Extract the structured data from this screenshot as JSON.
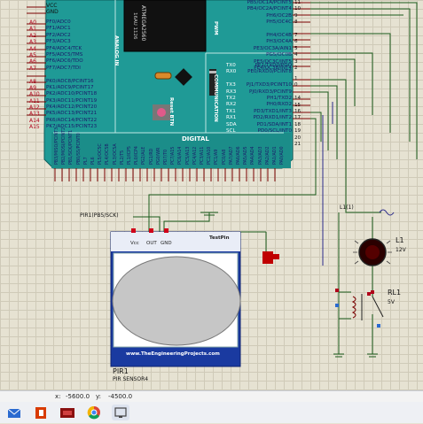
{
  "board": {
    "power_pins": [
      "VCC",
      "GND"
    ],
    "analog_pins": [
      "A0",
      "A1",
      "A2",
      "A3",
      "A4",
      "A5",
      "A6",
      "A7",
      "",
      "A8",
      "A9",
      "A10",
      "A11",
      "A12",
      "A13",
      "A14",
      "A15"
    ],
    "analog_ports": [
      "PF0/ADC0",
      "PF1/ADC1",
      "PF2/ADC2",
      "PF3/ADC3",
      "PF4/ADC4/TCK",
      "PF5/ADC5/TMS",
      "PF6/ADC6/TDO",
      "PF7/ADC7/TDI",
      "",
      "PK0/ADC8/PCINT16",
      "PK1/ADC9/PCINT17",
      "PK2/ADC10/PCINT18",
      "PK3/ADC11/PCINT19",
      "PK4/ADC12/PCINT20",
      "PK5/ADC13/PCINT21",
      "PK6/ADC14/PCINT22",
      "PK7/ADC15/PCINT23"
    ],
    "chip_label": "ATMEGA2560",
    "chip_sub": "16AU 1126",
    "analog_in_label": "ANALOG IN",
    "pwm_label": "PWM",
    "communication_label": "COMMUNICATION",
    "reset_label": "Reset BTN",
    "digital_label": "DIGITAL",
    "pwm_ports": [
      "PB5/OC1A/PCINT5",
      "PB4/OC2A/PCINT4",
      "PH6/OC2B",
      "PH5/OC4C",
      "",
      "PH4/OC4B",
      "PH3/OC4A",
      "PE3/OC3A/AIN1",
      "PG5/OC0B",
      "PE5/OC3C/INT5",
      "PE4/OC3B/INT4"
    ],
    "pwm_numbers": [
      "11",
      "10",
      "9",
      "8",
      "",
      "7",
      "6",
      "5",
      "4",
      "3",
      "2"
    ],
    "comm_ports": [
      "PE1/TXD0/PDO",
      "PE0/RXD0/PCINT8",
      "",
      "PJ1/TXD3/PCINT10",
      "PJ0/RXD3/PCINT9",
      "PH1/TXD2",
      "PH0/RXD2",
      "PD3/TXD1/INT3",
      "PD2/RXD1/INT2",
      "PD1/SDA/INT1",
      "PD0/SCL/INT0"
    ],
    "comm_labels": [
      "TX0",
      "RX0",
      "",
      "TX3",
      "RX3",
      "TX2",
      "RX2",
      "TX1",
      "RX1",
      "SDA",
      "SCL"
    ],
    "comm_numbers": [
      "1",
      "0",
      "",
      "14",
      "15",
      "16",
      "17",
      "18",
      "19",
      "20",
      "21"
    ],
    "digital_ports": [
      "PB3/MISO/PCINT3",
      "PB2/MOSI/PCINT2",
      "PB1/SCK/PCINT1",
      "PB0/SS/PCINT0",
      "PL7",
      "PL6",
      "PL5/OC5C",
      "PL4/OC5B",
      "PL3/OC5A",
      "PL2/T5",
      "PL1/ICP5",
      "PL0/ICP4",
      "PG2/ALE",
      "PG1/RD",
      "PG0/WR",
      "PD7/T0",
      "PC7/A15",
      "PC6/A14",
      "PC5/A13",
      "PC4/A12",
      "PC3/A11",
      "PC2/A10",
      "PC1/A9",
      "PC0/A8",
      "PA7/AD7",
      "PA6/AD6",
      "PA5/AD5",
      "PA4/AD4",
      "PA3/AD3",
      "PA2/AD2",
      "PA1/AD1",
      "PA0/AD0"
    ]
  },
  "pir": {
    "net_label": "PIR1(PB5/SCK)",
    "pins": [
      "Vcc",
      "OUT",
      "GND"
    ],
    "test_pin": "TestPin",
    "website": "www.TheEngineeringProjects.com",
    "ref": "PIR1",
    "name": "PIR SENSOR4"
  },
  "lamp": {
    "net_label": "L1(1)",
    "ref": "L1",
    "value": "12V"
  },
  "relay": {
    "ref": "RL1",
    "value": "5V"
  },
  "status": {
    "x_label": "x:",
    "x_value": "-5600.0",
    "y_label": "y:",
    "y_value": "-4500.0"
  },
  "colors": {
    "board": "#1f9a96",
    "wire": "#1a5a1a",
    "pin": "#b0001a",
    "canvas": "#e6e2d2"
  },
  "taskbar_icons": [
    "mail-icon",
    "office-icon",
    "proteus-icon",
    "chrome-icon",
    "screen-icon"
  ]
}
